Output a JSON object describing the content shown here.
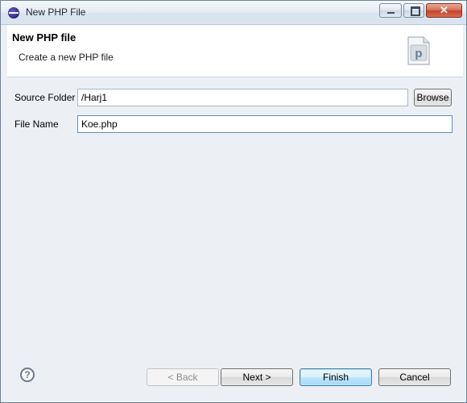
{
  "window": {
    "title": "New PHP File",
    "controls": {
      "minimize": "minimize",
      "maximize": "maximize",
      "close": "✕"
    }
  },
  "header": {
    "title": "New PHP file",
    "subtitle": "Create a new PHP file",
    "icon": "php-file-icon"
  },
  "form": {
    "source_folder": {
      "label": "Source Folder",
      "value": "/Harj1"
    },
    "browse_label": "Browse",
    "file_name": {
      "label": "File Name",
      "value": "Koe.php"
    }
  },
  "footer": {
    "help": "?",
    "back_label": "< Back",
    "next_label": "Next >",
    "finish_label": "Finish",
    "cancel_label": "Cancel"
  }
}
